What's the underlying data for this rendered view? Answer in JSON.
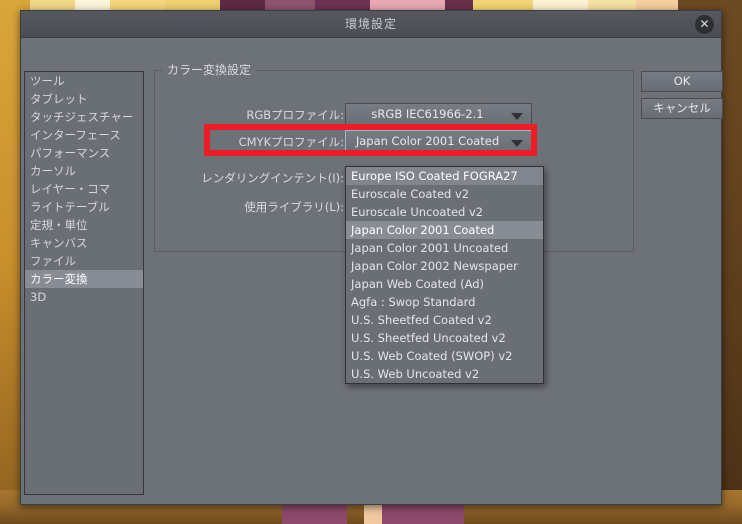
{
  "window": {
    "title": "環境設定",
    "close_icon": "close-icon",
    "close_glyph": "✕"
  },
  "sidebar": {
    "items": [
      {
        "label": "ツール",
        "selected": false
      },
      {
        "label": "タブレット",
        "selected": false
      },
      {
        "label": "タッチジェスチャー",
        "selected": false
      },
      {
        "label": "インターフェース",
        "selected": false
      },
      {
        "label": "パフォーマンス",
        "selected": false
      },
      {
        "label": "カーソル",
        "selected": false
      },
      {
        "label": "レイヤー・コマ",
        "selected": false
      },
      {
        "label": "ライトテーブル",
        "selected": false
      },
      {
        "label": "定規・単位",
        "selected": false
      },
      {
        "label": "キャンバス",
        "selected": false
      },
      {
        "label": "ファイル",
        "selected": false
      },
      {
        "label": "カラー変換",
        "selected": true
      },
      {
        "label": "3D",
        "selected": false
      }
    ]
  },
  "main": {
    "group_title": "カラー変換設定",
    "rows": [
      {
        "label": "RGBプロファイル:",
        "value": "sRGB IEC61966-2.1"
      },
      {
        "label": "CMYKプロファイル:",
        "value": "Japan Color 2001 Coated"
      },
      {
        "label": "レンダリングインテント(I):",
        "value": ""
      },
      {
        "label": "使用ライブラリ(L):",
        "value": ""
      }
    ]
  },
  "dropdown": {
    "open": true,
    "options": [
      {
        "label": "Europe ISO Coated FOGRA27",
        "state": "hover"
      },
      {
        "label": "Euroscale Coated v2",
        "state": "normal"
      },
      {
        "label": "Euroscale Uncoated v2",
        "state": "normal"
      },
      {
        "label": "Japan Color 2001 Coated",
        "state": "selected"
      },
      {
        "label": "Japan Color 2001 Uncoated",
        "state": "normal"
      },
      {
        "label": "Japan Color 2002 Newspaper",
        "state": "normal"
      },
      {
        "label": "Japan Web Coated (Ad)",
        "state": "normal"
      },
      {
        "label": "Agfa : Swop Standard",
        "state": "normal"
      },
      {
        "label": "U.S. Sheetfed Coated v2",
        "state": "normal"
      },
      {
        "label": "U.S. Sheetfed Uncoated v2",
        "state": "normal"
      },
      {
        "label": "U.S. Web Coated (SWOP) v2",
        "state": "normal"
      },
      {
        "label": "U.S. Web Uncoated v2",
        "state": "normal"
      }
    ]
  },
  "buttons": {
    "ok": "OK",
    "cancel": "キャンセル"
  },
  "annotation": {
    "color": "#ee1c24",
    "target": "CMYKプロファイル"
  }
}
